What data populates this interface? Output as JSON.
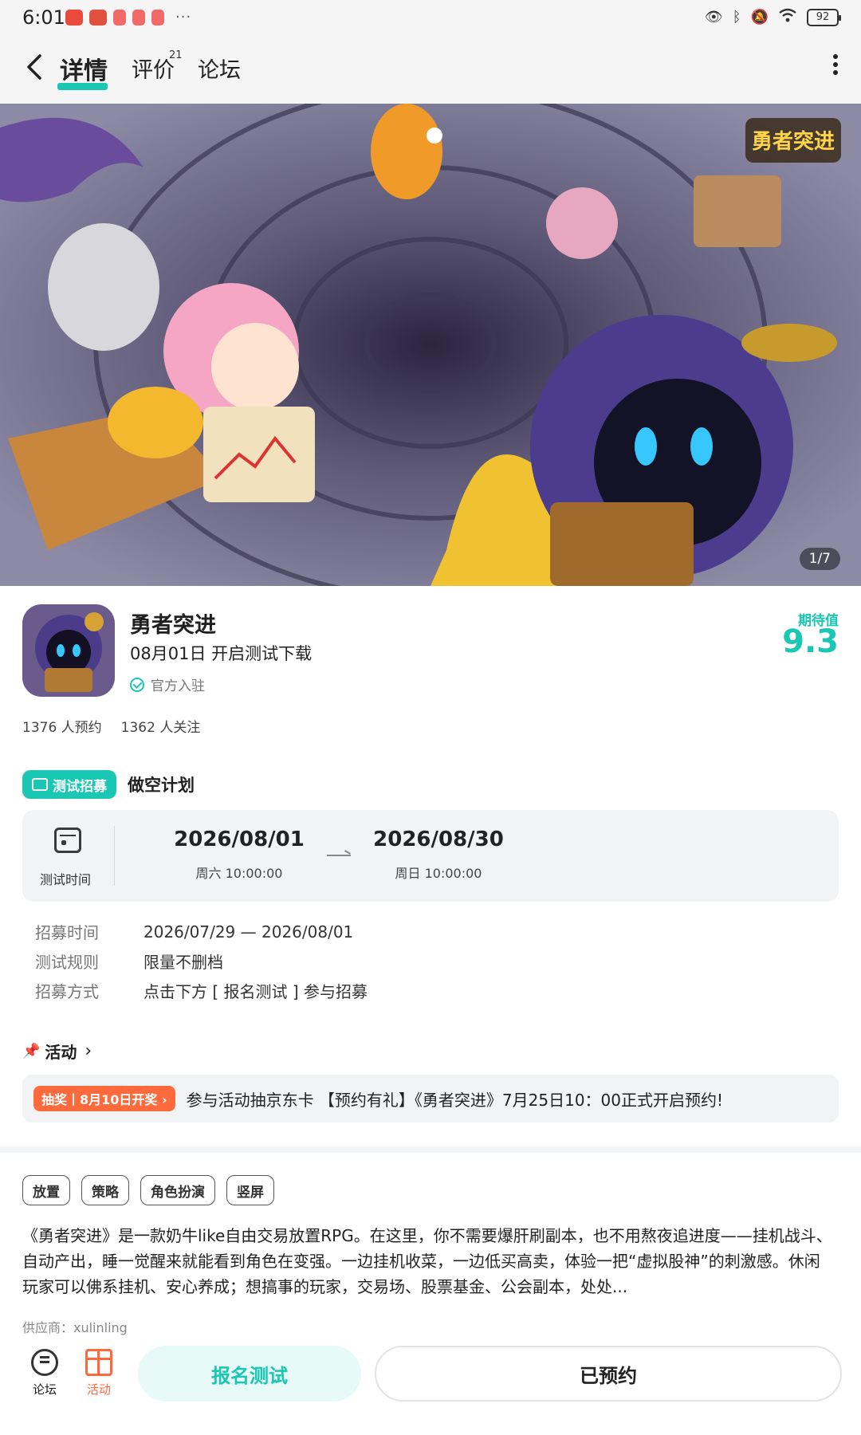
{
  "status_bar": {
    "time": "6:01",
    "more": "···",
    "battery": "92"
  },
  "nav": {
    "tabs": [
      {
        "label": "详情"
      },
      {
        "label": "评价"
      },
      {
        "label": "论坛"
      }
    ],
    "review_count": "21"
  },
  "banner": {
    "counter": "1/7",
    "logo_text": "勇者突进"
  },
  "app": {
    "name": "勇者突进",
    "launch": "08月01日 开启测试下载",
    "official": "官方入驻",
    "expect_label": "期待值",
    "expect_value": "9.3"
  },
  "stats": {
    "reservations": "1376 人预约",
    "followers": "1362 人关注"
  },
  "test": {
    "badge": "测试招募",
    "name": "做空计划",
    "time_label": "测试时间",
    "start_date": "2026/08/01",
    "start_time": "周六  10:00:00",
    "end_date": "2026/08/30",
    "end_time": "周日  10:00:00"
  },
  "info": [
    {
      "key": "招募时间",
      "value": "2026/07/29 — 2026/08/01"
    },
    {
      "key": "测试规则",
      "value": "限量不删档"
    },
    {
      "key": "招募方式",
      "value": "点击下方 [ 报名测试 ] 参与招募"
    }
  ],
  "activity": {
    "title": "活动",
    "badge": "抽奖丨8月10日开奖 ›",
    "text": "参与活动抽京东卡 【预约有礼】《勇者突进》7月25日10：00正式开启预约!"
  },
  "tags": [
    "放置",
    "策略",
    "角色扮演",
    "竖屏"
  ],
  "description": "《勇者突进》是一款奶牛like自由交易放置RPG。在这里，你不需要爆肝刷副本，也不用熬夜追进度——挂机战斗、自动产出，睡一觉醒来就能看到角色在变强。一边挂机收菜，一边低买高卖，体验一把“虚拟股神”的刺激感。休闲玩家可以佛系挂机、安心养成；想搞事的玩家，交易场、股票基金、公会副本，处处...",
  "supplier": "供应商：xulinling",
  "bottom": {
    "forum": "论坛",
    "activity": "活动",
    "signup": "报名测试",
    "reserved": "已预约"
  },
  "colors": {
    "accent": "#19c7b3",
    "orange": "#ff6a3d"
  }
}
